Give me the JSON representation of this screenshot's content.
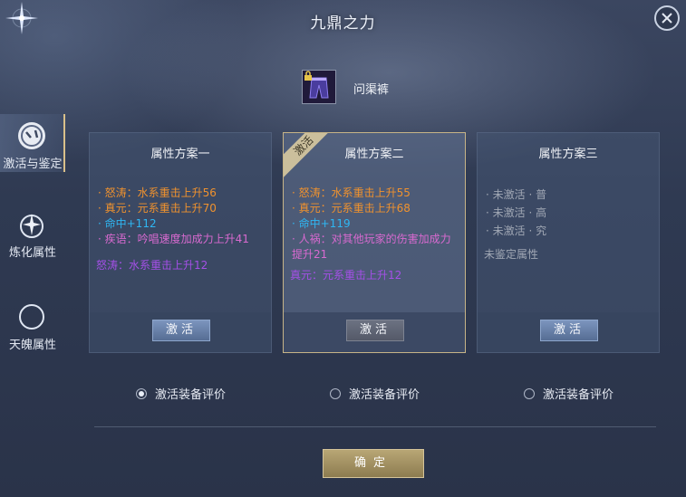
{
  "window": {
    "title": "九鼎之力"
  },
  "sidebar": {
    "items": [
      {
        "label": "激活与鉴定",
        "icon": "gauge-icon",
        "active": true
      },
      {
        "label": "炼化属性",
        "icon": "sparkle-icon",
        "active": false
      },
      {
        "label": "天魄属性",
        "icon": "crescent-icon",
        "active": false
      }
    ]
  },
  "item": {
    "name": "问渠裤",
    "icon": "pants-icon"
  },
  "cards": [
    {
      "title": "属性方案一",
      "lines": [
        {
          "text": "· 怒涛：水系重击上升56",
          "color": "orange"
        },
        {
          "text": "· 真元：元系重击上升70",
          "color": "orange"
        },
        {
          "text": "· 命中+112",
          "color": "cyan"
        },
        {
          "text": "· 疾语：吟唱速度加成力上升41",
          "color": "pink"
        }
      ],
      "extra": "怒涛：水系重击上升12",
      "button": "激活"
    },
    {
      "title": "属性方案二",
      "ribbon": "激活",
      "lines": [
        {
          "text": "· 怒涛：水系重击上升55",
          "color": "orange"
        },
        {
          "text": "· 真元：元系重击上升68",
          "color": "orange"
        },
        {
          "text": "· 命中+119",
          "color": "cyan"
        },
        {
          "text": "· 人祸：对其他玩家的伤害加成力提升21",
          "color": "pink"
        }
      ],
      "extra": "真元：元系重击上升12",
      "button": "激活"
    },
    {
      "title": "属性方案三",
      "lines": [
        {
          "text": "· 未激活 · 普",
          "color": "gray"
        },
        {
          "text": "· 未激活 · 高",
          "color": "gray"
        },
        {
          "text": "· 未激活 · 究",
          "color": "gray"
        }
      ],
      "extra": "未鉴定属性",
      "button": "激活"
    }
  ],
  "radios": [
    {
      "label": "激活装备评价",
      "checked": true
    },
    {
      "label": "激活装备评价",
      "checked": false
    },
    {
      "label": "激活装备评价",
      "checked": false
    }
  ],
  "confirm_label": "确定",
  "colors": {
    "orange": "#f0922e",
    "cyan": "#2fb6f2",
    "pink": "#d86ad0",
    "purple": "#a550e8",
    "gray": "#a0a7b4",
    "gold_border": "#c7b487"
  }
}
